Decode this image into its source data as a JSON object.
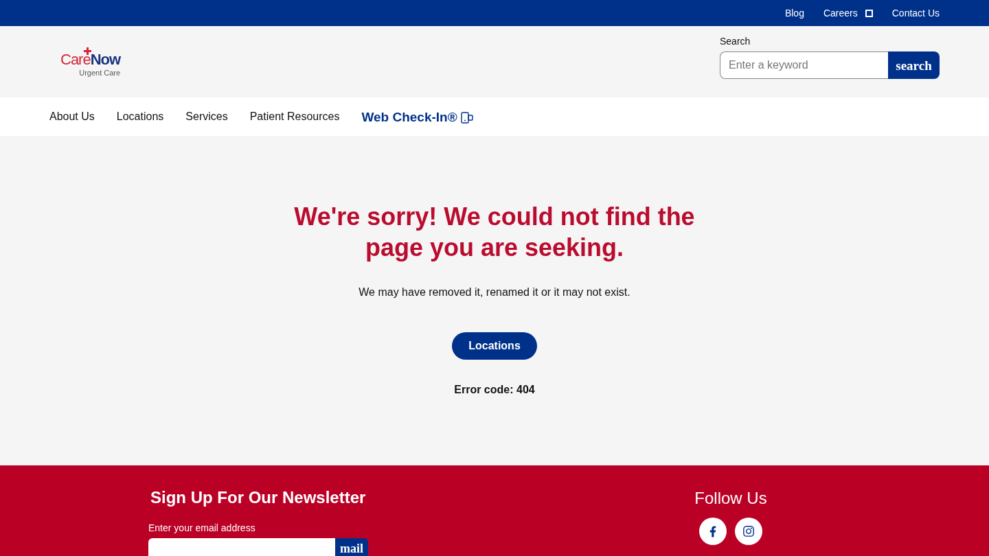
{
  "top_bar": {
    "links": [
      {
        "label": "Blog",
        "external": false
      },
      {
        "label": "Careers",
        "external": true
      },
      {
        "label": "Contact Us",
        "external": false
      }
    ]
  },
  "header": {
    "logo": {
      "brand_part_1": "Care",
      "brand_part_2": "Now",
      "tagline": "Urgent Care"
    },
    "search": {
      "label": "Search",
      "placeholder": "Enter a keyword",
      "button": "search"
    }
  },
  "nav": {
    "items": [
      {
        "label": "About Us",
        "kind": "link"
      },
      {
        "label": "Locations",
        "kind": "link"
      },
      {
        "label": "Services",
        "kind": "link"
      },
      {
        "label": "Patient Resources",
        "kind": "link"
      },
      {
        "label": "Web Check-In®",
        "kind": "check_in"
      }
    ]
  },
  "error_page": {
    "heading": "We're sorry! We could not find the page you are seeking.",
    "message": "We may have removed it, renamed it or it may not exist.",
    "button": "Locations",
    "error_code": "Error code: 404"
  },
  "footer": {
    "newsletter": {
      "title": "Sign Up For Our Newsletter",
      "field_label": "Enter your email address",
      "button": "mail"
    },
    "follow": {
      "title": "Follow Us",
      "social": [
        {
          "kind": "facebook"
        },
        {
          "kind": "instagram"
        }
      ]
    }
  }
}
